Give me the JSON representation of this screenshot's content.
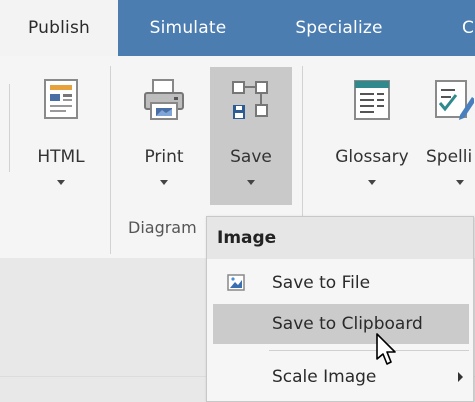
{
  "tabs": [
    {
      "label": "Publish",
      "active": true
    },
    {
      "label": "Simulate",
      "active": false
    },
    {
      "label": "Specialize",
      "active": false
    },
    {
      "label": "C",
      "active": false
    }
  ],
  "ribbon": {
    "buttons": [
      {
        "label": "HTML",
        "icon": "html-report-icon"
      },
      {
        "label": "Print",
        "icon": "printer-icon"
      },
      {
        "label": "Save",
        "icon": "diagram-save-icon",
        "pressed": true
      },
      {
        "label": "Glossary",
        "icon": "glossary-icon"
      },
      {
        "label": "Spelli",
        "icon": "spell-check-icon"
      }
    ],
    "group_label": "Diagram"
  },
  "menu": {
    "header": "Image",
    "items": [
      {
        "label": "Save to File",
        "icon": "image-file-icon"
      },
      {
        "label": "Save to Clipboard",
        "highlighted": true
      },
      {
        "label": "Scale Image",
        "has_submenu": true
      }
    ]
  },
  "colors": {
    "tabbar": "#4b7db1",
    "pressed_button": "#c9c9c9",
    "menu_highlight": "#cbcbcb"
  }
}
